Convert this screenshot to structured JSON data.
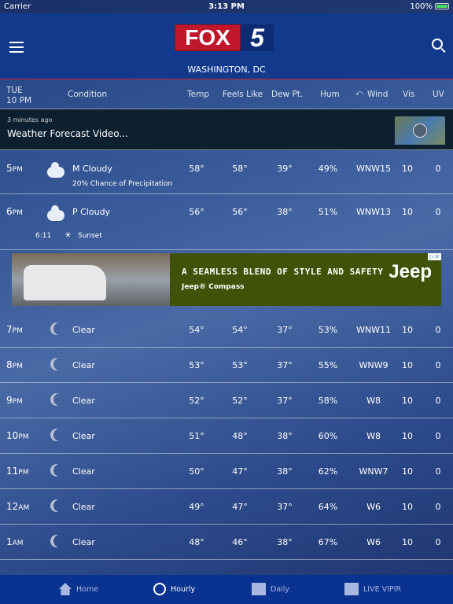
{
  "status": {
    "carrier": "Carrier",
    "time": "3:13 PM",
    "battery": "100%"
  },
  "header": {
    "logo_fox": "FOX",
    "logo_num": "5",
    "location": "WASHINGTON, DC"
  },
  "columns": {
    "day": "TUE",
    "time": "10 PM",
    "condition": "Condition",
    "temp": "Temp",
    "feels": "Feels Like",
    "dew": "Dew Pt.",
    "hum": "Hum",
    "wind": "Wind",
    "vis": "Vis",
    "uv": "UV"
  },
  "video": {
    "ago": "3 minutes ago",
    "title": "Weather Forecast Video..."
  },
  "rows": [
    {
      "hour": "5",
      "ampm": "PM",
      "icon": "partly-cloudy-icon",
      "cond": "M Cloudy",
      "temp": "58°",
      "feels": "58°",
      "dew": "39°",
      "hum": "49%",
      "wind": "WNW15",
      "vis": "10",
      "uv": "0",
      "note": "20% Chance of Precipitation"
    },
    {
      "hour": "6",
      "ampm": "PM",
      "icon": "partly-cloudy-icon",
      "cond": "P Cloudy",
      "temp": "56°",
      "feels": "56°",
      "dew": "38°",
      "hum": "51%",
      "wind": "WNW13",
      "vis": "10",
      "uv": "0",
      "sunset_time": "6:11",
      "sunset_label": "Sunset"
    },
    {
      "hour": "7",
      "ampm": "PM",
      "icon": "moon-icon",
      "cond": "Clear",
      "temp": "54°",
      "feels": "54°",
      "dew": "37°",
      "hum": "53%",
      "wind": "WNW11",
      "vis": "10",
      "uv": "0"
    },
    {
      "hour": "8",
      "ampm": "PM",
      "icon": "moon-icon",
      "cond": "Clear",
      "temp": "53°",
      "feels": "53°",
      "dew": "37°",
      "hum": "55%",
      "wind": "WNW9",
      "vis": "10",
      "uv": "0"
    },
    {
      "hour": "9",
      "ampm": "PM",
      "icon": "moon-icon",
      "cond": "Clear",
      "temp": "52°",
      "feels": "52°",
      "dew": "37°",
      "hum": "58%",
      "wind": "W8",
      "vis": "10",
      "uv": "0"
    },
    {
      "hour": "10",
      "ampm": "PM",
      "icon": "moon-icon",
      "cond": "Clear",
      "temp": "51°",
      "feels": "48°",
      "dew": "38°",
      "hum": "60%",
      "wind": "W8",
      "vis": "10",
      "uv": "0"
    },
    {
      "hour": "11",
      "ampm": "PM",
      "icon": "moon-icon",
      "cond": "Clear",
      "temp": "50°",
      "feels": "47°",
      "dew": "38°",
      "hum": "62%",
      "wind": "WNW7",
      "vis": "10",
      "uv": "0"
    },
    {
      "hour": "12",
      "ampm": "AM",
      "icon": "moon-icon",
      "cond": "Clear",
      "temp": "49°",
      "feels": "47°",
      "dew": "37°",
      "hum": "64%",
      "wind": "W6",
      "vis": "10",
      "uv": "0"
    },
    {
      "hour": "1",
      "ampm": "AM",
      "icon": "moon-icon",
      "cond": "Clear",
      "temp": "48°",
      "feels": "46°",
      "dew": "38°",
      "hum": "67%",
      "wind": "W6",
      "vis": "10",
      "uv": "0"
    }
  ],
  "ad": {
    "headline": "A SEAMLESS BLEND OF STYLE AND SAFETY",
    "sub": "Jeep® Compass",
    "brand": "Jeep",
    "adchoices": "▷✕"
  },
  "tabs": [
    {
      "label": "Home",
      "icon": "home-icon"
    },
    {
      "label": "Hourly",
      "icon": "clock-icon",
      "active": true
    },
    {
      "label": "Daily",
      "icon": "calendar-icon"
    },
    {
      "label": "LIVE VIPIR",
      "icon": "map-icon"
    }
  ]
}
